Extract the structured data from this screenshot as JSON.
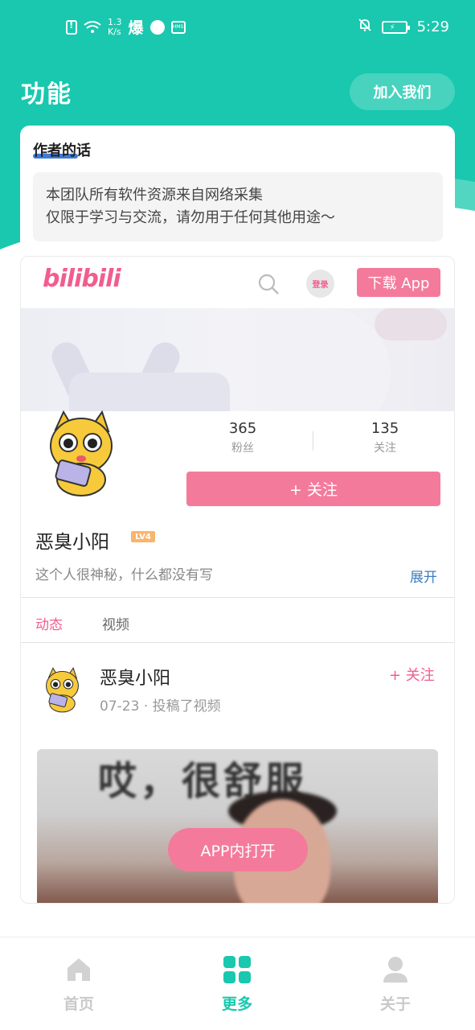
{
  "status_bar": {
    "net_speed_value": "1.3",
    "net_speed_unit": "K/s",
    "bao_label": "爆",
    "hms_label": "HMS",
    "time": "5:29"
  },
  "header": {
    "title": "功能",
    "join_button": "加入我们"
  },
  "author_card": {
    "title": "作者的话",
    "line1": "本团队所有软件资源来自网络采集",
    "line2": "仅限于学习与交流，请勿用于任何其他用途～"
  },
  "bili": {
    "logo_text": "bilibili",
    "login_label": "登录",
    "download_button": "下载 App",
    "fans_count": "365",
    "fans_label": "粉丝",
    "following_count": "135",
    "following_label": "关注",
    "follow_button": "+ 关注",
    "username": "恶臭小阳",
    "level": "LV4",
    "bio": "这个人很神秘，什么都没有写",
    "expand": "展开",
    "tabs": [
      "动态",
      "视频"
    ],
    "post": {
      "author": "恶臭小阳",
      "meta": "07-23 · 投稿了视频",
      "follow": "+ 关注",
      "thumbnail_caption": "哎，很舒服",
      "open_in_app": "APP内打开"
    }
  },
  "bottom_nav": {
    "items": [
      {
        "label": "首页",
        "icon": "home-icon",
        "active": false
      },
      {
        "label": "更多",
        "icon": "grid-icon",
        "active": true
      },
      {
        "label": "关于",
        "icon": "person-icon",
        "active": false
      }
    ]
  },
  "colors": {
    "teal": "#19c8ae",
    "bili_pink": "#f25d8e",
    "button_pink": "#f47a9b",
    "link_blue": "#3c7dc2"
  }
}
